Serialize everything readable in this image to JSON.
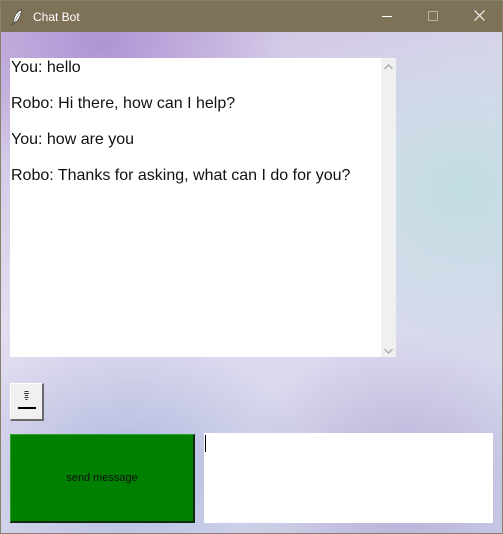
{
  "window": {
    "title": "Chat Bot",
    "app_icon": "feather-icon",
    "controls": {
      "minimize_icon": "minimize-icon",
      "maximize_icon": "maximize-icon",
      "close_icon": "close-icon"
    },
    "titlebar_color": "#7d7157"
  },
  "chat": {
    "messages": [
      "You: hello",
      "Robo: Hi there, how can I help?",
      "You: how are you",
      "Robo: Thanks for asking, what can I do for you?"
    ]
  },
  "small_button": {
    "icon": "tiny-image-icon"
  },
  "send_button": {
    "label": "send message",
    "color": "#008000"
  },
  "message_input": {
    "value": ""
  }
}
